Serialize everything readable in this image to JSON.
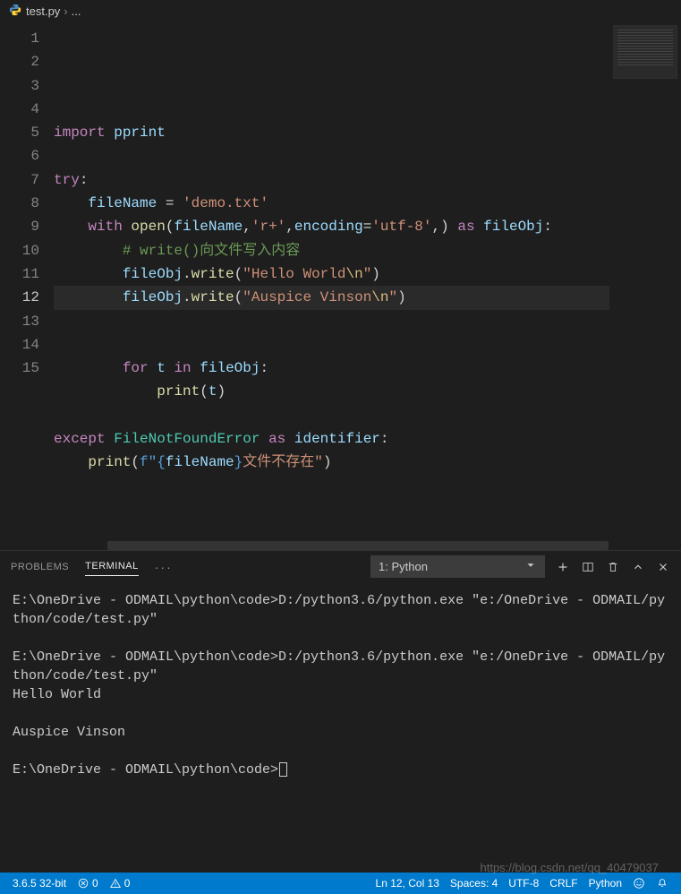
{
  "breadcrumb": {
    "icon": "python",
    "file": "test.py",
    "sep": "›",
    "more": "..."
  },
  "lines": [
    "1",
    "2",
    "3",
    "4",
    "5",
    "6",
    "7",
    "8",
    "9",
    "10",
    "11",
    "12",
    "13",
    "14",
    "15"
  ],
  "code": {
    "l1": {
      "import": "import",
      "mod": "pprint"
    },
    "l3": {
      "try": "try",
      "colon": ":"
    },
    "l4": {
      "var": "fileName",
      "eq": " = ",
      "str": "'demo.txt'"
    },
    "l5": {
      "with": "with",
      "open": "open",
      "lp": "(",
      "arg1": "fileName",
      "c1": ",",
      "mode": "'r+'",
      "c2": ",",
      "enc": "encoding",
      "eq2": "=",
      "encv": "'utf-8'",
      "c3": ",",
      "rp": ")",
      "as": "as",
      "obj": "fileObj",
      "colon": ":"
    },
    "l6": {
      "comment": "# write()向文件写入内容"
    },
    "l7": {
      "obj": "fileObj",
      "dot": ".",
      "write": "write",
      "lp": "(",
      "s": "\"Hello World",
      "esc": "\\n",
      "s2": "\"",
      "rp": ")"
    },
    "l8": {
      "obj": "fileObj",
      "dot": ".",
      "write": "write",
      "lp": "(",
      "s": "\"Auspice Vinson",
      "esc": "\\n",
      "s2": "\"",
      "rp": ")"
    },
    "l11": {
      "for": "for",
      "t": "t",
      "in": "in",
      "obj": "fileObj",
      "colon": ":"
    },
    "l12": {
      "print": "print",
      "lp": "(",
      "t": "t",
      "rp": ")"
    },
    "l14": {
      "except": "except",
      "err": "FileNotFoundError",
      "as": "as",
      "id": "identifier",
      "colon": ":"
    },
    "l15": {
      "print": "print",
      "lp": "(",
      "f": "f\"",
      "lb": "{",
      "var": "fileName",
      "rb": "}",
      "txt": "文件不存在",
      "q": "\"",
      "rp": ")"
    }
  },
  "panel": {
    "tabs": {
      "problems": "PROBLEMS",
      "terminal": "TERMINAL",
      "more": "···"
    },
    "select": "1: Python"
  },
  "terminal": {
    "line1": "E:\\OneDrive - ODMAIL\\python\\code>D:/python3.6/python.exe \"e:/OneDrive - ODMAIL/python/code/test.py\"",
    "line2": "",
    "line3": "E:\\OneDrive - ODMAIL\\python\\code>D:/python3.6/python.exe \"e:/OneDrive - ODMAIL/python/code/test.py\"",
    "line4": "Hello World",
    "line5": "",
    "line6": "Auspice Vinson",
    "line7": "",
    "prompt": "E:\\OneDrive - ODMAIL\\python\\code>"
  },
  "status": {
    "python": "3.6.5 32-bit",
    "errors": "0",
    "warnings": "0",
    "pos": "Ln 12, Col 13",
    "spaces": "Spaces: 4",
    "encoding": "UTF-8",
    "eol": "CRLF",
    "lang": "Python"
  },
  "watermark": "https://blog.csdn.net/qq_40479037"
}
